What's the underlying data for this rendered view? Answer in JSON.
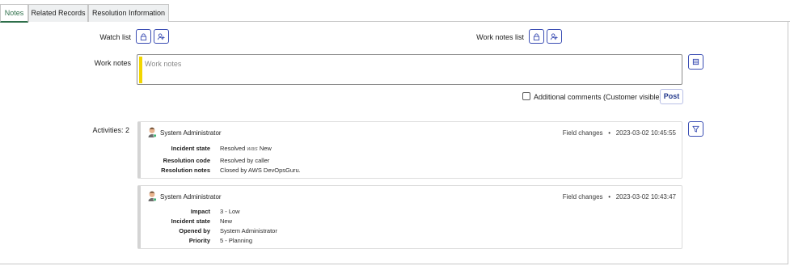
{
  "tabs": [
    {
      "label": "Notes"
    },
    {
      "label": "Related Records"
    },
    {
      "label": "Resolution Information"
    }
  ],
  "watch_list": {
    "label": "Watch list",
    "lock_icon": "lock-icon",
    "add_icon": "add-user-icon"
  },
  "work_notes_list": {
    "label": "Work notes list",
    "lock_icon": "lock-icon",
    "add_icon": "add-user-icon"
  },
  "work_notes": {
    "label": "Work notes",
    "placeholder": "Work notes",
    "value": "",
    "accent": "#f2d600",
    "template_icon": "templates-icon"
  },
  "additional_comments": {
    "label": "Additional comments (Customer visible)",
    "checked": false
  },
  "post_button": {
    "label": "Post"
  },
  "activities": {
    "label": "Activities: 2",
    "filter_icon": "filter-icon",
    "entries": [
      {
        "author": "System Administrator",
        "type": "Field changes",
        "timestamp": "2023-03-02 10:45:55",
        "fields": [
          {
            "key": "Incident state",
            "value": "Resolved",
            "was_label": "was",
            "previous": "New"
          },
          {
            "key": "Resolution code",
            "value": "Resolved by caller"
          },
          {
            "key": "Resolution notes",
            "value": "Closed by AWS DevOpsGuru."
          }
        ]
      },
      {
        "author": "System Administrator",
        "type": "Field changes",
        "timestamp": "2023-03-02 10:43:47",
        "fields": [
          {
            "key": "Impact",
            "value": "3 - Low"
          },
          {
            "key": "Incident state",
            "value": "New"
          },
          {
            "key": "Opened by",
            "value": "System Administrator"
          },
          {
            "key": "Priority",
            "value": "5 - Planning"
          }
        ]
      }
    ]
  },
  "colors": {
    "accent_green": "#2e6f4a",
    "button_blue": "#3a4db3",
    "post_text": "#243a8c"
  }
}
